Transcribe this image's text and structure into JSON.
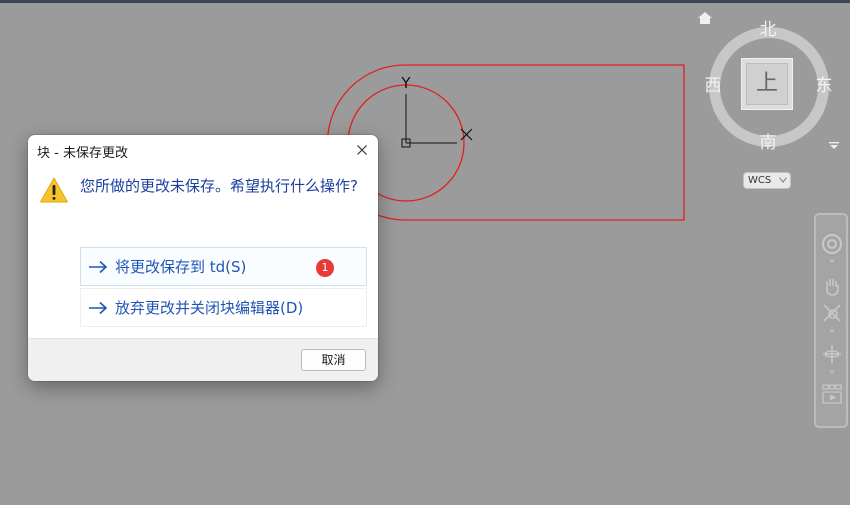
{
  "drawing": {
    "axis_y_label": "Y",
    "axis_x_label": "X"
  },
  "viewcube": {
    "north": "北",
    "south": "南",
    "west": "西",
    "east": "东",
    "face_label": "上",
    "wcs_label": "WCS"
  },
  "dialog": {
    "title": "块 - 未保存更改",
    "message": "您所做的更改未保存。希望执行什么操作?",
    "option_save": "将更改保存到 td(S)",
    "option_discard": "放弃更改并关闭块编辑器(D)",
    "badge_count": "1",
    "cancel_label": "取消"
  },
  "colors": {
    "canvas": "#9b9b9b",
    "geometry": "#e02020",
    "link": "#1f56b5"
  }
}
